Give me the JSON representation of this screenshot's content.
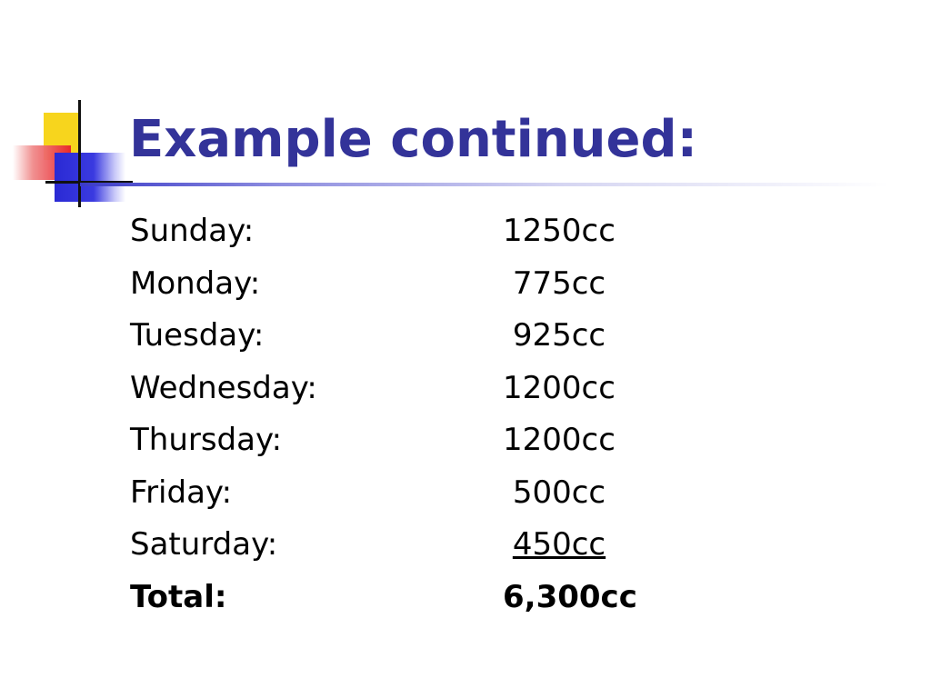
{
  "slide": {
    "title": "Example continued:",
    "rows": [
      {
        "day": "Sunday:",
        "amount": "1250cc"
      },
      {
        "day": "Monday:",
        "amount": "775cc"
      },
      {
        "day": "Tuesday:",
        "amount": "925cc"
      },
      {
        "day": "Wednesday:",
        "amount": "1200cc"
      },
      {
        "day": "Thursday:",
        "amount": "1200cc"
      },
      {
        "day": "Friday:",
        "amount": "500cc"
      },
      {
        "day": "Saturday:",
        "amount": "450cc"
      }
    ],
    "total": {
      "label": "Total:",
      "amount": "6,300cc"
    }
  },
  "colors": {
    "title": "#333399",
    "accent_yellow": "#f7d51d",
    "accent_red": "#e8202a",
    "accent_blue": "#2a2ad4"
  }
}
